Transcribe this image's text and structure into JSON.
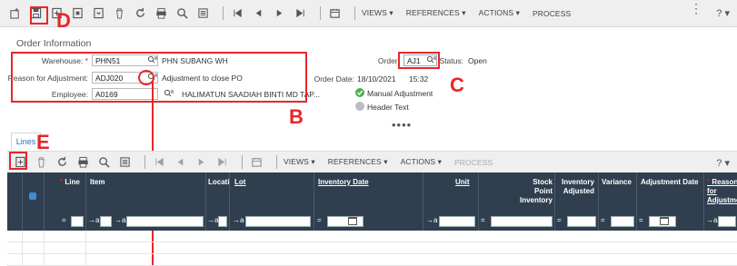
{
  "toolbar": {
    "menus": [
      {
        "label": "VIEWS ▾"
      },
      {
        "label": "REFERENCES ▾"
      },
      {
        "label": "ACTIONS ▾"
      },
      {
        "label": "PROCESS"
      }
    ],
    "help": "? ▾"
  },
  "form": {
    "section_title": "Order Information",
    "warehouse": {
      "label": "Warehouse:",
      "value": "PHN51",
      "desc": "PHN SUBANG WH"
    },
    "reason": {
      "label": "Reason for Adjustment:",
      "value": "ADJ020",
      "desc": "Adjustment to close PO"
    },
    "employee": {
      "label": "Employee:",
      "value": "A0169",
      "desc": "HALIMATUN SAADIAH BINTI MD TAP..."
    },
    "order": {
      "label": "Order:",
      "value": "AJ1"
    },
    "status": {
      "label": "Status:",
      "value": "Open"
    },
    "order_date": {
      "label": "Order Date:",
      "date": "18/10/2021",
      "time": "15:32"
    },
    "manual_adjustment": "Manual Adjustment",
    "header_text": "Header Text",
    "more": "••••"
  },
  "lines": {
    "tab_label": "Lines",
    "menus": [
      {
        "label": "VIEWS ▾"
      },
      {
        "label": "REFERENCES ▾"
      },
      {
        "label": "ACTIONS ▾"
      },
      {
        "label": "PROCESS"
      }
    ],
    "help": "? ▾",
    "columns": [
      {
        "label": "Line"
      },
      {
        "label": "Item"
      },
      {
        "label": "Locati"
      },
      {
        "label": "Lot"
      },
      {
        "label": "Inventory Date"
      },
      {
        "label": "Unit"
      },
      {
        "label": "Stock Point Inventory"
      },
      {
        "label": "Inventory Adjusted"
      },
      {
        "label": "Variance"
      },
      {
        "label": "Adjustment Date"
      },
      {
        "label": "Reason for Adjustment"
      }
    ]
  },
  "annotations": {
    "b": "B",
    "c": "C",
    "d": "D",
    "e": "E"
  },
  "colors": {
    "annotation": "#e8262a",
    "grid_header": "#2f3f4f",
    "link_blue": "#2f6fb3"
  }
}
